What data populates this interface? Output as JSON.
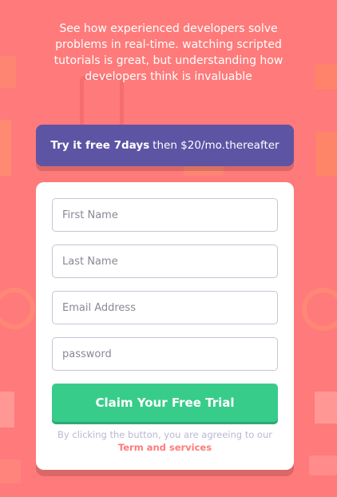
{
  "intro": {
    "text": "See how experienced developers solve problems in real-time. watching scripted tutorials is great, but understanding how developers think is invaluable"
  },
  "promo": {
    "bold": "Try it free 7days",
    "rest": "then $20/mo.thereafter"
  },
  "form": {
    "first_name_placeholder": "First Name",
    "last_name_placeholder": "Last Name",
    "email_placeholder": "Email Address",
    "password_placeholder": "password",
    "submit_label": "Claim Your Free Trial",
    "terms_prefix": "By clicking the button, you are agreeing to our",
    "terms_link": "Term and services"
  },
  "colors": {
    "background": "#ff7a7a",
    "promo": "#5e54a4",
    "cta": "#38cc8b"
  }
}
